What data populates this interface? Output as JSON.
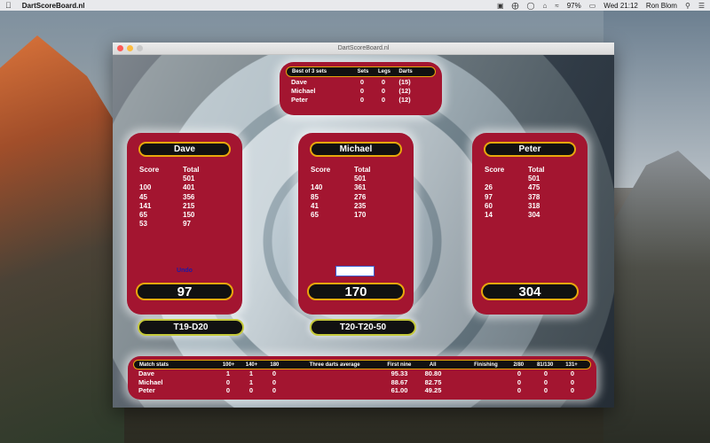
{
  "menubar": {
    "app_name": "DartScoreBoard.nl",
    "battery": "97%",
    "clock": "Wed 21:12",
    "user": "Ron Blom"
  },
  "window": {
    "title": "DartScoreBoard.nl"
  },
  "summary": {
    "best_of_prefix": "Best of",
    "best_of_value": "3 sets",
    "headers": {
      "sets": "Sets",
      "legs": "Legs",
      "darts": "Darts"
    },
    "rows": [
      {
        "name": "Dave",
        "sets": "0",
        "legs": "0",
        "darts": "(15)"
      },
      {
        "name": "Michael",
        "sets": "0",
        "legs": "0",
        "darts": "(12)"
      },
      {
        "name": "Peter",
        "sets": "0",
        "legs": "0",
        "darts": "(12)"
      }
    ]
  },
  "players": [
    {
      "name": "Dave",
      "score_label": "Score",
      "total_label": "Total",
      "rows": [
        {
          "score": "",
          "total": "501"
        },
        {
          "score": "100",
          "total": "401"
        },
        {
          "score": "45",
          "total": "356"
        },
        {
          "score": "141",
          "total": "215"
        },
        {
          "score": "65",
          "total": "150"
        },
        {
          "score": "53",
          "total": "97"
        }
      ],
      "undo": "Undo",
      "remaining": "97",
      "checkout": "T19-D20"
    },
    {
      "name": "Michael",
      "score_label": "Score",
      "total_label": "Total",
      "rows": [
        {
          "score": "",
          "total": "501"
        },
        {
          "score": "140",
          "total": "361"
        },
        {
          "score": "85",
          "total": "276"
        },
        {
          "score": "41",
          "total": "235"
        },
        {
          "score": "65",
          "total": "170"
        }
      ],
      "remaining": "170",
      "checkout": "T20-T20-50"
    },
    {
      "name": "Peter",
      "score_label": "Score",
      "total_label": "Total",
      "rows": [
        {
          "score": "",
          "total": "501"
        },
        {
          "score": "26",
          "total": "475"
        },
        {
          "score": "97",
          "total": "378"
        },
        {
          "score": "60",
          "total": "318"
        },
        {
          "score": "14",
          "total": "304"
        }
      ],
      "remaining": "304"
    }
  ],
  "stats": {
    "headers": {
      "title": "Match stats",
      "h100": "100+",
      "h140": "140+",
      "h180": "180",
      "tda": "Three darts average",
      "first_nine": "First nine",
      "all": "All",
      "finishing": "Finishing",
      "f280": "2/80",
      "f81": "81/130",
      "f131": "131+"
    },
    "rows": [
      {
        "name": "Dave",
        "h100": "1",
        "h140": "1",
        "h180": "0",
        "first_nine": "95.33",
        "all": "80.80",
        "f280": "0",
        "f81": "0",
        "f131": "0"
      },
      {
        "name": "Michael",
        "h100": "0",
        "h140": "1",
        "h180": "0",
        "first_nine": "88.67",
        "all": "82.75",
        "f280": "0",
        "f81": "0",
        "f131": "0"
      },
      {
        "name": "Peter",
        "h100": "0",
        "h140": "0",
        "h180": "0",
        "first_nine": "61.00",
        "all": "49.25",
        "f280": "0",
        "f81": "0",
        "f131": "0"
      }
    ]
  },
  "colors": {
    "panel_red": "#a31530",
    "pill_border": "#e8a70c",
    "checkout_border": "#c4c83a"
  }
}
